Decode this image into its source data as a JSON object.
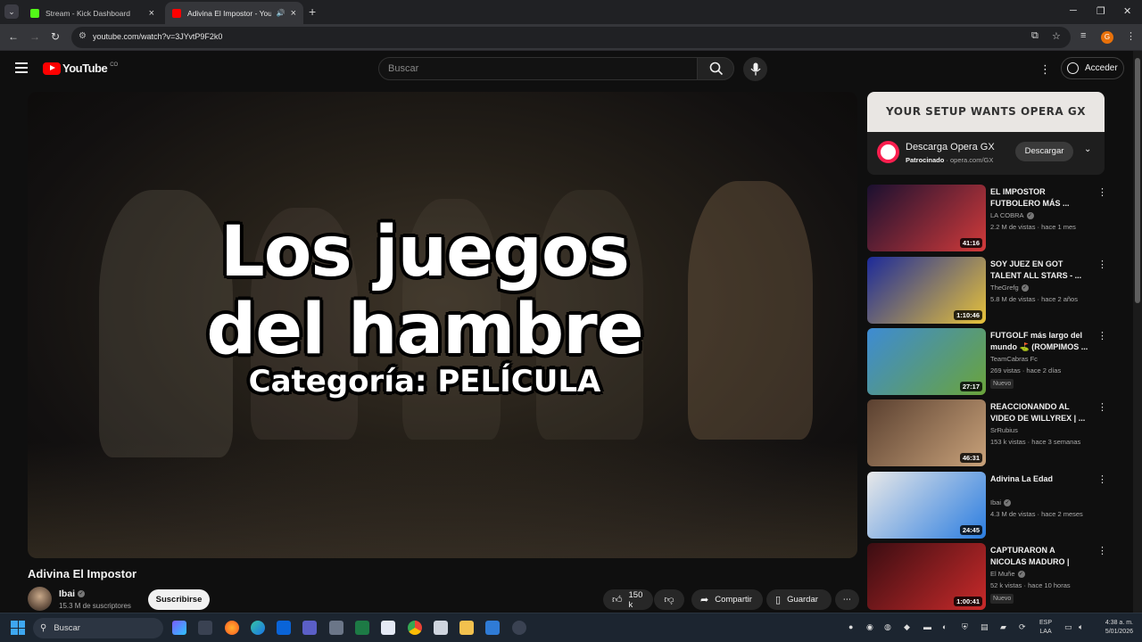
{
  "browser": {
    "tabs": [
      {
        "title": "Stream - Kick Dashboard",
        "favicon_color": "#53fc18",
        "active": false
      },
      {
        "title": "Adivina El Impostor - YouTu",
        "favicon_color": "#ff0000",
        "active": true
      }
    ],
    "url": "youtube.com/watch?v=3JYvtP9F2k0",
    "profile_initial": "G"
  },
  "header": {
    "logo": "YouTube",
    "country": "CO",
    "search_placeholder": "Buscar",
    "signin": "Acceder"
  },
  "player": {
    "overlay_line1": "Los juegos",
    "overlay_line2": "del hambre",
    "overlay_line3": "Categoría: PELÍCULA"
  },
  "video": {
    "title": "Adivina El Impostor",
    "channel": "Ibai",
    "subscribers": "15.3 M de suscriptores",
    "subscribe": "Suscribirse",
    "likes": "150 k",
    "share": "Compartir",
    "save": "Guardar"
  },
  "ad": {
    "banner": "YOUR SETUP WANTS OPERA GX",
    "title": "Descarga Opera GX",
    "sponsored": "Patrocinado",
    "domain": "opera.com/GX",
    "button": "Descargar"
  },
  "recommendations": [
    {
      "title": "EL IMPOSTOR FUTBOLERO MÁS ...",
      "channel": "LA COBRA",
      "verified": true,
      "meta": "2.2 M de vistas · hace 1 mes",
      "duration": "41:16",
      "badge": "",
      "thumb": [
        "#1a1030",
        "#d23a3a"
      ]
    },
    {
      "title": "SOY JUEZ EN GOT TALENT ALL STARS - ...",
      "channel": "TheGrefg",
      "verified": true,
      "meta": "5.8 M de vistas · hace 2 años",
      "duration": "1:10:46",
      "badge": "",
      "thumb": [
        "#1c2a9a",
        "#e7c23a"
      ]
    },
    {
      "title": "FUTGOLF más largo del mundo ⛳ (ROMPIMOS ...",
      "channel": "TeamCabras Fc",
      "verified": false,
      "meta": "269 vistas · hace 2 días",
      "duration": "27:17",
      "badge": "Nuevo",
      "thumb": [
        "#3d8bd4",
        "#6aa43a"
      ]
    },
    {
      "title": "REACCIONANDO AL VIDEO DE WILLYREX | ...",
      "channel": "SrRubius",
      "verified": false,
      "meta": "153 k vistas · hace 3 semanas",
      "duration": "46:31",
      "badge": "",
      "thumb": [
        "#5a4030",
        "#c9a27a"
      ]
    },
    {
      "title": "Adivina La Edad",
      "channel": "Ibai",
      "verified": true,
      "meta": "4.3 M de vistas · hace 2 meses",
      "duration": "24:45",
      "badge": "",
      "thumb": [
        "#e8e8e8",
        "#2b7de0"
      ]
    },
    {
      "title": "CAPTURARON A NICOLAS MADURO | Recuento, ...",
      "channel": "El Muñe",
      "verified": true,
      "meta": "52 k vistas · hace 10 horas",
      "duration": "1:00:41",
      "badge": "Nuevo",
      "thumb": [
        "#3a0d12",
        "#c92a2a"
      ]
    }
  ],
  "taskbar": {
    "search": "Buscar",
    "lang_line1": "ESP",
    "lang_line2": "LAA",
    "time": "4:38 a. m.",
    "date": "5/01/2026"
  }
}
